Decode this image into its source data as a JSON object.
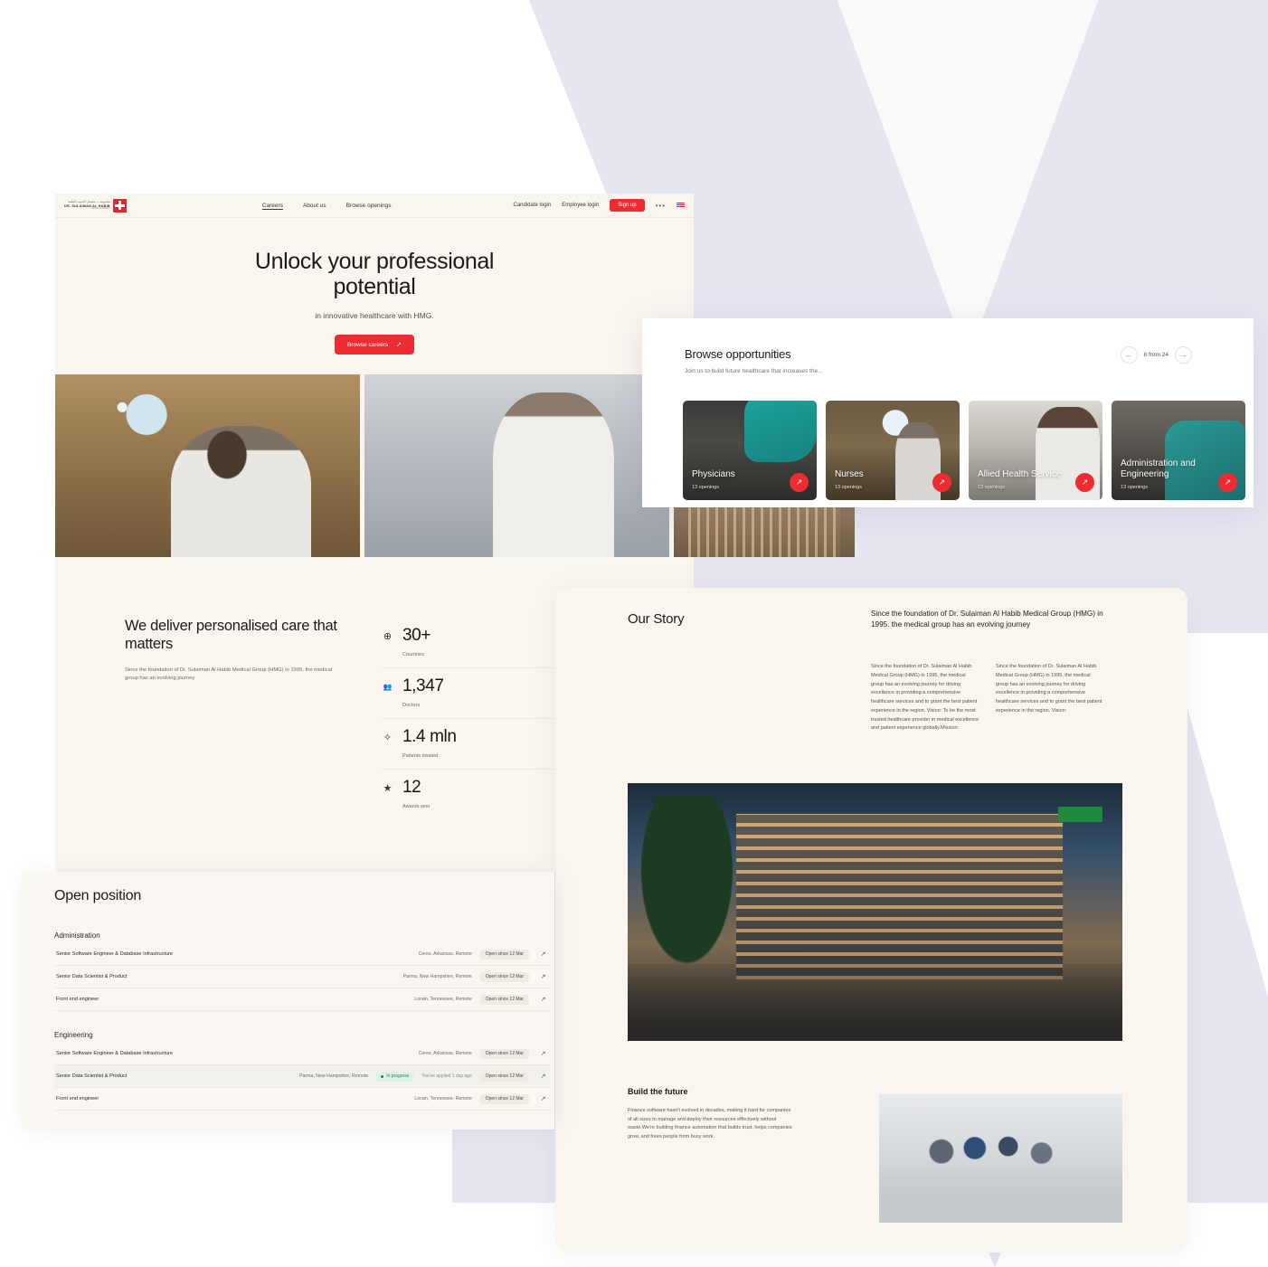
{
  "brand": {
    "accent": "#ee2b32",
    "logo_line_ar": "مجموعة د. سليمان الحبيب الطبية",
    "logo_line_en": "DR. SULAIMAN AL HABIB",
    "logo_line_sub": "MEDICAL GROUP"
  },
  "nav": {
    "links": [
      {
        "label": "Careers"
      },
      {
        "label": "About us"
      },
      {
        "label": "Browse openings"
      }
    ],
    "candidate_login": "Candidate login",
    "employee_login": "Employee login",
    "signup": "Sign up",
    "more": "•••"
  },
  "hero": {
    "title": "Unlock your professional potential",
    "subtitle": "in innovative healthcare with HMG.",
    "cta": "Browse careers",
    "cta_arrow": "↗"
  },
  "browse": {
    "title": "Browse opportunities",
    "subtitle": "Join us to build future healthcare that increases the...",
    "pager_label": "8 from 24",
    "prev_arrow": "←",
    "next_arrow": "→",
    "cards": [
      {
        "title": "Physicians",
        "openings": "13 openings",
        "fab": "↗"
      },
      {
        "title": "Nurses",
        "openings": "13 openings",
        "fab": "↗"
      },
      {
        "title": "Allied Health Service",
        "openings": "13 openings",
        "fab": "↗"
      },
      {
        "title": "Administration and Engineering",
        "openings": "13 openings",
        "fab": "↗"
      }
    ]
  },
  "deliver": {
    "title": "We deliver personalised care that matters",
    "body": "Since the foundation of Dr. Sulaiman Al Habib Medical Group (HMG) in 1995, the medical group has an evolving journey"
  },
  "stats": [
    {
      "icon": "globe-icon",
      "glyph": "⊕",
      "value": "30+",
      "label": "Countries"
    },
    {
      "icon": "people-icon",
      "glyph": "👥",
      "value": "1,347",
      "label": "Doctors"
    },
    {
      "icon": "sparkle-icon",
      "glyph": "✧",
      "value": "1.4 mln",
      "label": "Patients treated"
    },
    {
      "icon": "star-icon",
      "glyph": "★",
      "value": "12",
      "label": "Awards won"
    }
  ],
  "open_positions": {
    "title": "Open position",
    "groups": [
      {
        "name": "Administration",
        "rows": [
          {
            "title": "Senior Software Engineer & Database Infrastructure",
            "location": "Ceres, Arkansas, Remote",
            "status": "",
            "applied": "",
            "since": "Open since 12 Mar",
            "arrow": "↗",
            "highlighted": false
          },
          {
            "title": "Senior Data Scientist & Product",
            "location": "Parma, New Hampshire, Remote",
            "status": "",
            "applied": "",
            "since": "Open since 12 Mar",
            "arrow": "↗",
            "highlighted": false
          },
          {
            "title": "Front end engineer",
            "location": "Lorain, Tennessee, Remote",
            "status": "",
            "applied": "",
            "since": "Open since 12 Mar",
            "arrow": "↗",
            "highlighted": false
          }
        ]
      },
      {
        "name": "Engineering",
        "rows": [
          {
            "title": "Senior Software Engineer & Database Infrastructure",
            "location": "Ceres, Arkansas, Remote",
            "status": "",
            "applied": "",
            "since": "Open since 12 Mar",
            "arrow": "↗",
            "highlighted": false
          },
          {
            "title": "Senior Data Scientist & Product",
            "location": "Parma, New Hampshire, Remote",
            "status": "In progress",
            "applied": "You've applied 1 day ago",
            "since": "Open since 12 Mar",
            "arrow": "↗",
            "highlighted": true
          },
          {
            "title": "Front end engineer",
            "location": "Lorain, Tennessee, Remote",
            "status": "",
            "applied": "",
            "since": "Open since 12 Mar",
            "arrow": "↗",
            "highlighted": false
          }
        ]
      }
    ]
  },
  "story": {
    "title": "Our Story",
    "lead": "Since the foundation of Dr. Sulaiman Al Habib Medical Group (HMG) in 1995. the medical group has an evolving journey",
    "col1": "Since the foundation of Dr. Sulaiman Al Habib Medical Group (HMG) in 1995, the medical group has an evolving journey for driving excellence in providing a comprehensive healthcare services and to grant the best patient experience in the region. Vision: To be the most trusted healthcare provider in medical excellence and patient experience globally.Mission:",
    "col2": "Since the foundation of Dr. Sulaiman Al Habib Medical Group (HMG) in 1995, the medical group has an evolving journey for driving excellence in providing a comprehensive healthcare services and to grant the best patient experience in the region. Vision:"
  },
  "build": {
    "title": "Build the future",
    "body": "Finance software hasn't evolved in decades, making it hard for companies of all sizes to manage and deploy their resources effectively without waste.We're building finance automation that builds trust, helps companies grow, and frees people from busy work."
  }
}
